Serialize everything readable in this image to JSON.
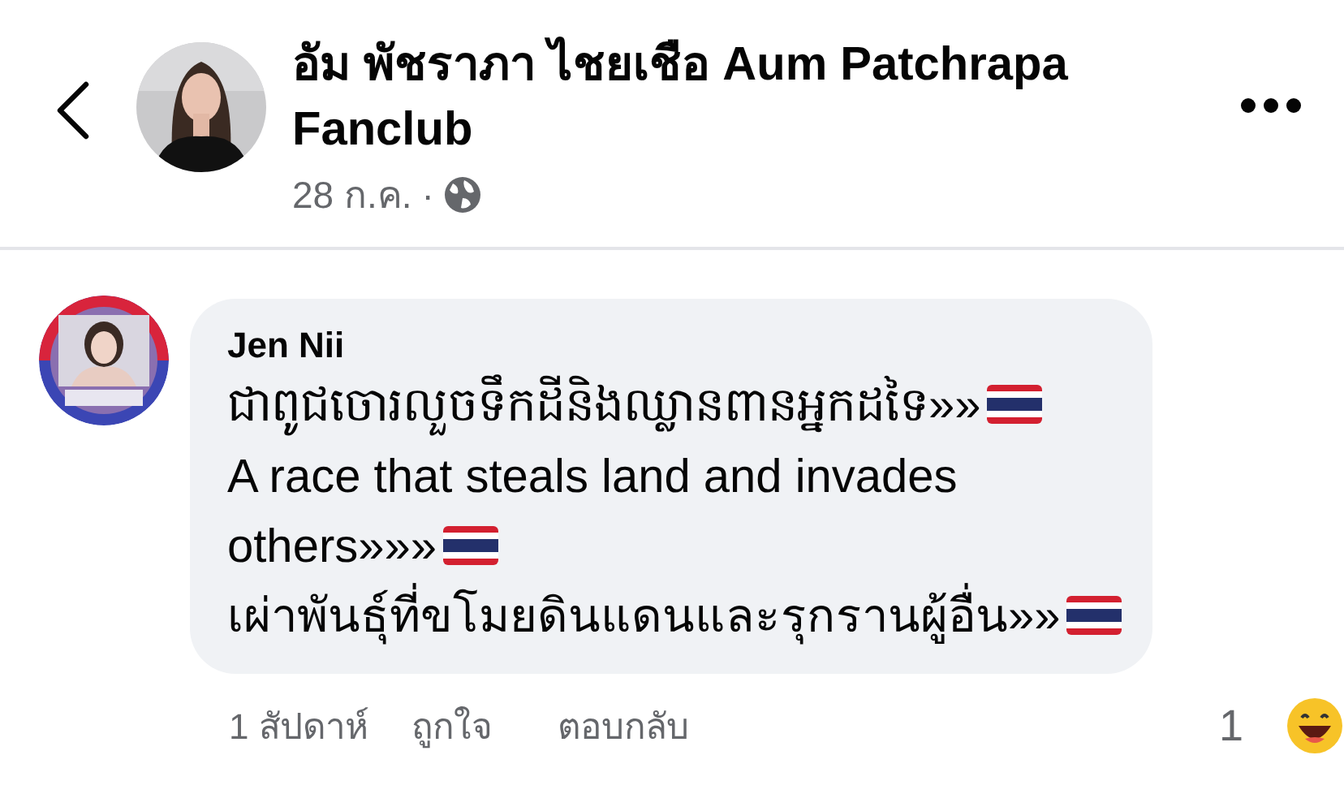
{
  "post": {
    "author": "อัม พัชราภา ไชยเชือ Aum Patchrapa Fanclub",
    "date": "28 ก.ค.",
    "separator": "·"
  },
  "comment": {
    "author": "Jen Nii",
    "lines": [
      {
        "text": "ជាពូជចោរលួចទឹកដីនិងឈ្លានពានអ្នកដទៃ»»",
        "flag": true
      },
      {
        "text": "A race that steals land and invades",
        "flag": false
      },
      {
        "text": "others»»»",
        "flag": true
      },
      {
        "text": "เผ่าพันธุ์ที่ขโมยดินแดนและรุกรานผู้อื่น»»",
        "flag": true
      }
    ],
    "time": "1 สัปดาห์",
    "actions": [
      "ถูกใจ",
      "ตอบกลับ"
    ],
    "reaction_count": "1"
  }
}
